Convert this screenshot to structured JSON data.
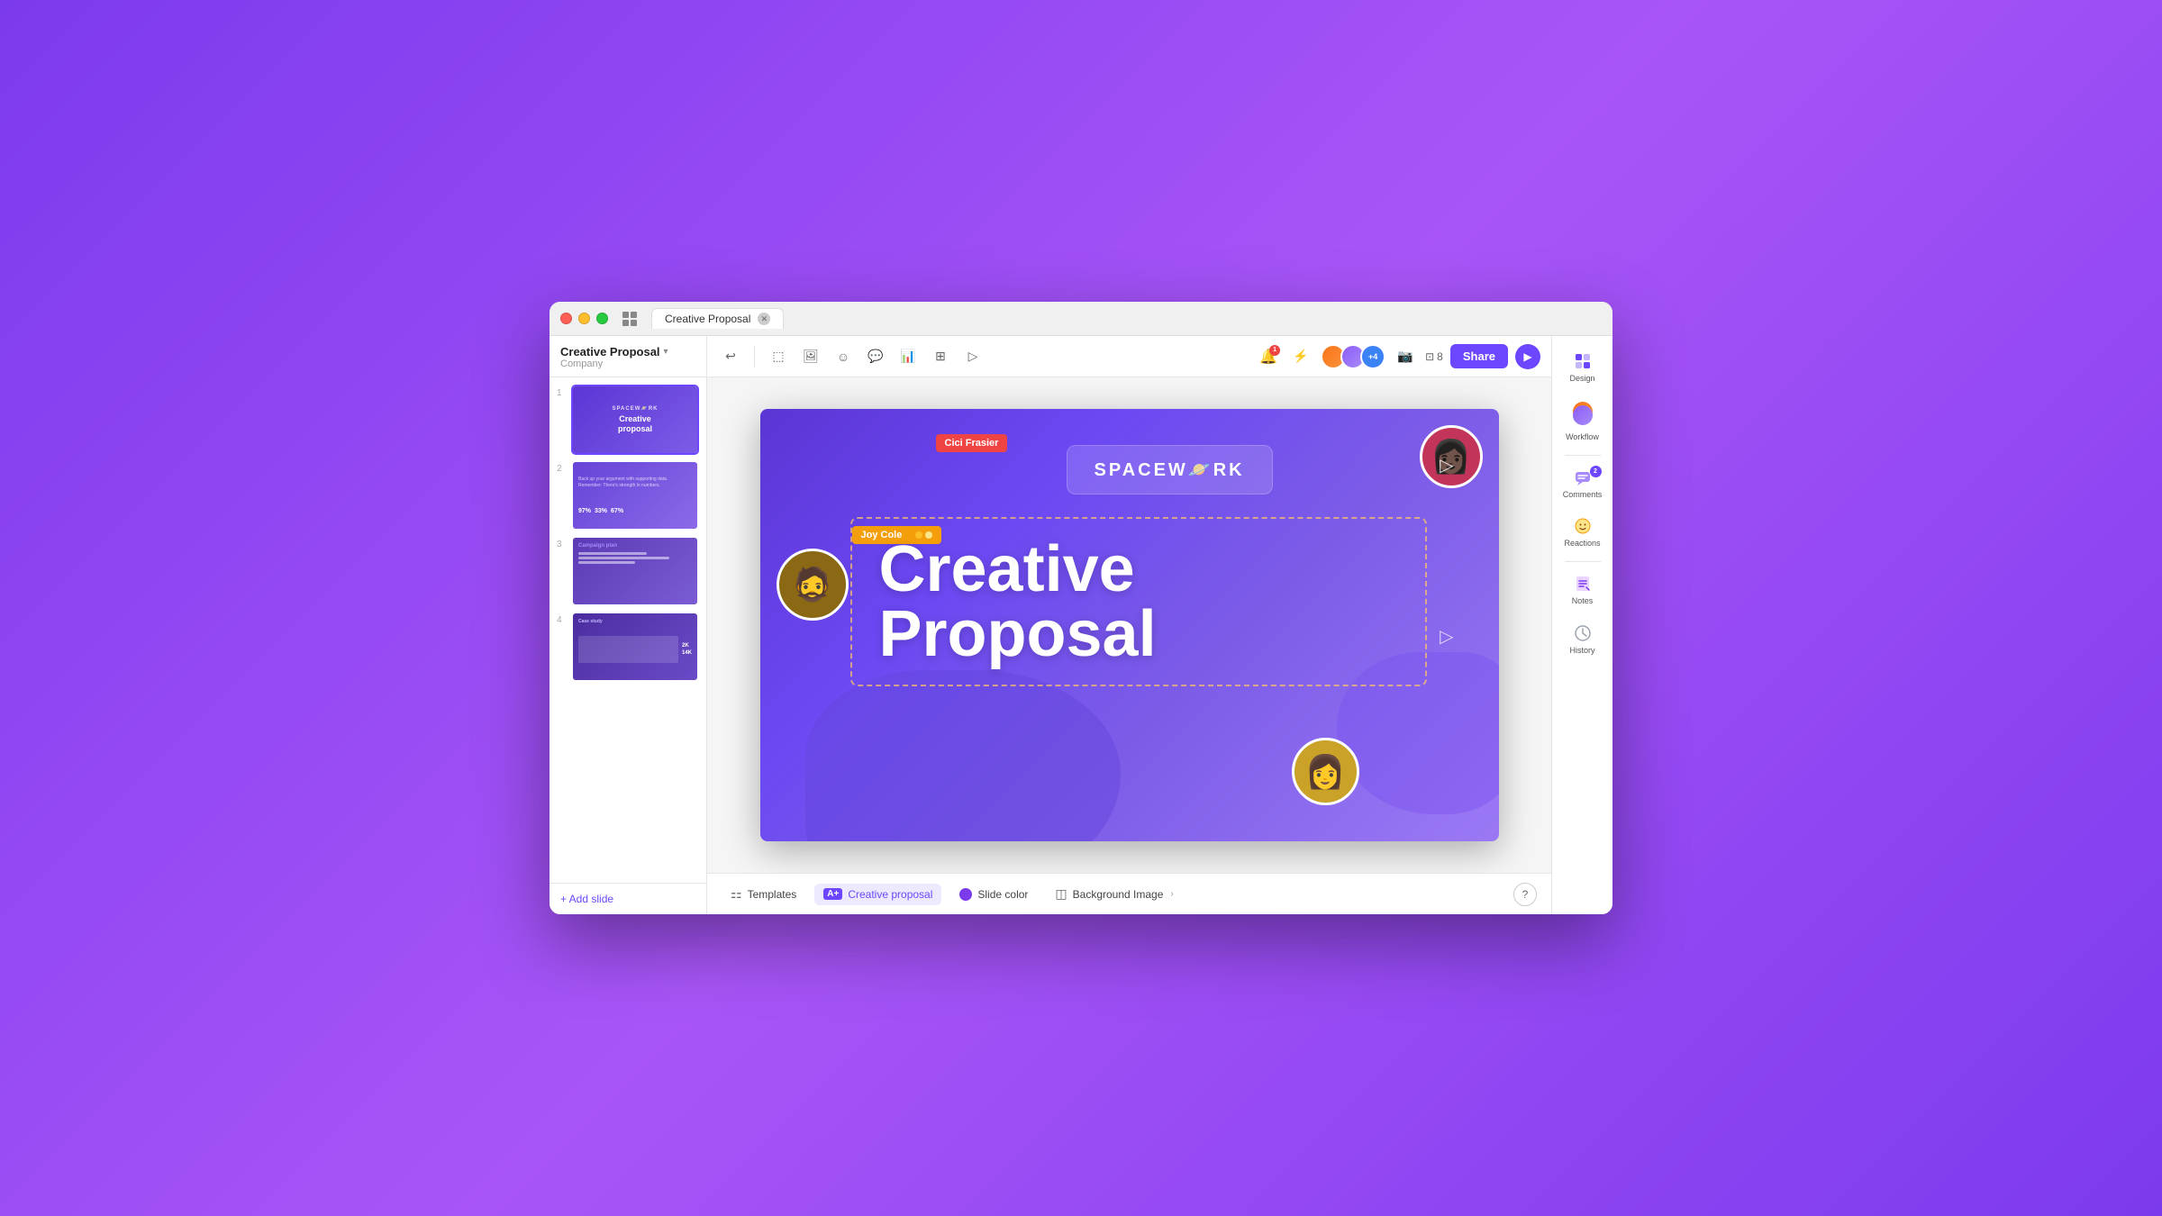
{
  "app": {
    "window_title": "Creative Proposal",
    "tab_label": "Creative Proposal"
  },
  "sidebar": {
    "title": "Creative Proposal",
    "subtitle": "Company",
    "slides": [
      {
        "num": "1",
        "label": "Slide 1"
      },
      {
        "num": "2",
        "label": "Slide 2"
      },
      {
        "num": "3",
        "label": "Slide 3"
      },
      {
        "num": "4",
        "label": "Slide 4"
      }
    ],
    "add_slide_label": "+ Add slide"
  },
  "toolbar": {
    "undo_label": "Undo",
    "share_label": "Share",
    "page_count": "8",
    "avatars": [
      "+4"
    ]
  },
  "canvas": {
    "spacework_label": "SPACEW🪐RK",
    "creative_heading_line1": "Creative",
    "creative_heading_line2": "Proposal",
    "cici_label": "Cici Frasier",
    "joy_label": "Joy Cole"
  },
  "right_panel": {
    "items": [
      {
        "id": "design",
        "label": "Design",
        "icon": "design"
      },
      {
        "id": "workflow",
        "label": "Workflow",
        "icon": "workflow"
      },
      {
        "id": "comments",
        "label": "Comments",
        "icon": "comments",
        "badge": "2"
      },
      {
        "id": "reactions",
        "label": "Reactions",
        "icon": "reactions"
      },
      {
        "id": "notes",
        "label": "Notes",
        "icon": "notes"
      },
      {
        "id": "history",
        "label": "History",
        "icon": "history"
      }
    ]
  },
  "bottom_bar": {
    "templates_label": "Templates",
    "creative_proposal_label": "Creative proposal",
    "slide_color_label": "Slide color",
    "background_image_label": "Background Image"
  }
}
